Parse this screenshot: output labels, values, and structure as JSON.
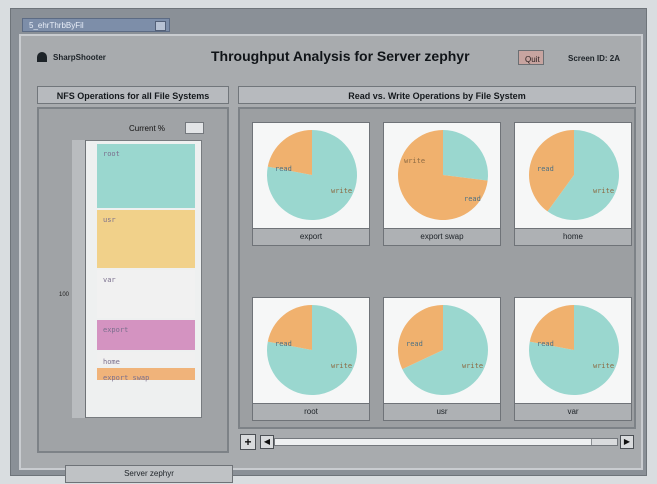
{
  "window": {
    "tab_title": "5_ehrThrbByFil",
    "app_name": "SharpShooter",
    "title": "Throughput Analysis for Server zephyr",
    "quit_label": "Quit",
    "screen_id": "Screen ID: 2A"
  },
  "left_panel": {
    "title": "NFS Operations for all File Systems",
    "current_label": "Current %",
    "current_value": "",
    "scale_label": "100",
    "server_button": "Server zephyr",
    "segments": [
      {
        "label": "root",
        "color": "#9ad7cf"
      },
      {
        "label": "usr",
        "color": "#f1d18a"
      },
      {
        "label": "var",
        "color": "#f1f1f1"
      },
      {
        "label": "export",
        "color": "#d493c1"
      },
      {
        "label": "home",
        "color": "#f0f0f0"
      },
      {
        "label": "export swap",
        "color": "#f0b37a"
      }
    ]
  },
  "right_panel": {
    "title": "Read vs. Write Operations by File System",
    "labels": [
      "export",
      "export swap",
      "home",
      "root",
      "usr",
      "var"
    ],
    "pie_labels": {
      "read": "read",
      "write": "write"
    },
    "charts": [
      {
        "read": 0.78,
        "write": 0.22
      },
      {
        "read": 0.27,
        "write": 0.73
      },
      {
        "read": 0.6,
        "write": 0.4
      },
      {
        "read": 0.78,
        "write": 0.22
      },
      {
        "read": 0.68,
        "write": 0.32
      },
      {
        "read": 0.78,
        "write": 0.22
      }
    ],
    "colors": {
      "read": "#9ad7cf",
      "write": "#f0b16e"
    }
  },
  "scroll": {
    "plus": "+",
    "left": "◀",
    "right": "▶"
  }
}
